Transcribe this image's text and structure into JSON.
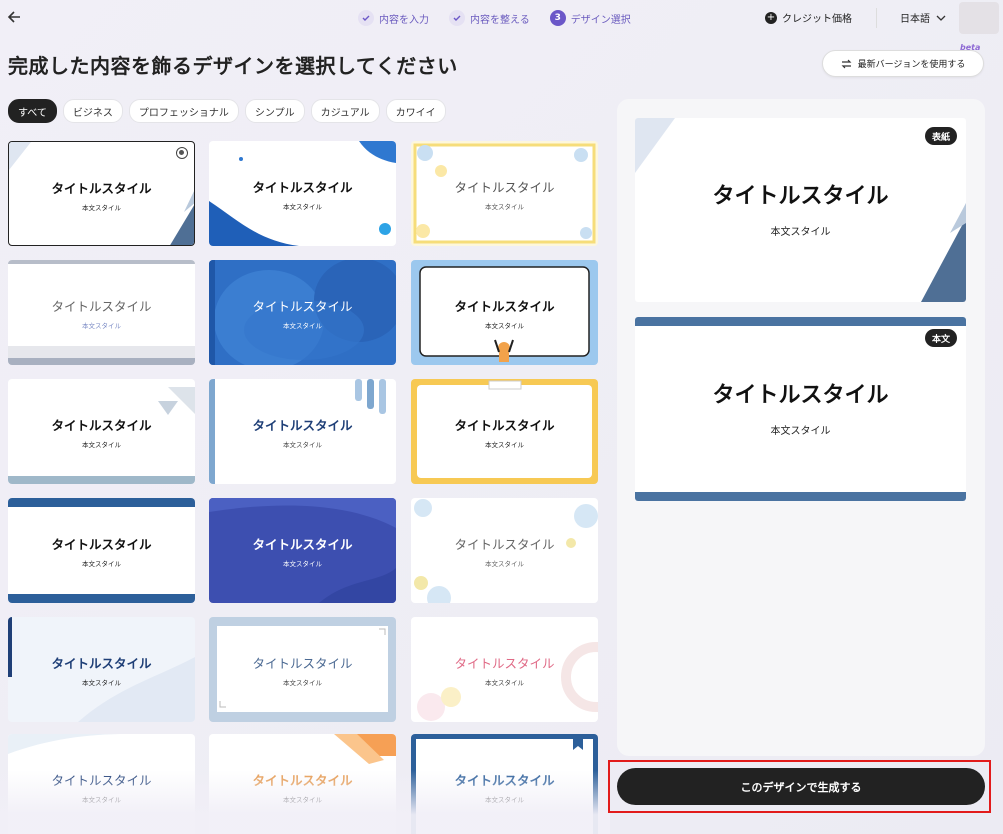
{
  "header": {
    "steps": [
      {
        "label": "内容を入力",
        "state": "done"
      },
      {
        "label": "内容を整える",
        "state": "done"
      },
      {
        "number": "3",
        "label": "デザイン選択",
        "state": "current"
      }
    ],
    "credit_label": "クレジット価格",
    "language": "日本語"
  },
  "page_title": "完成した内容を飾るデザインを選択してください",
  "new_version_button": "最新バージョンを使用する",
  "beta_label": "beta",
  "filters": [
    "すべて",
    "ビジネス",
    "プロフェッショナル",
    "シンプル",
    "カジュアル",
    "カワイイ"
  ],
  "active_filter": "すべて",
  "card_title": "タイトルスタイル",
  "card_body": "本文スタイル",
  "preview": {
    "cover_tag": "表紙",
    "body_tag": "本文",
    "title": "タイトルスタイル",
    "body": "本文スタイル"
  },
  "generate_button": "このデザインで生成する",
  "colors": {
    "accent": "#6b57c8",
    "dark": "#222222",
    "highlight": "#e21b1b"
  }
}
